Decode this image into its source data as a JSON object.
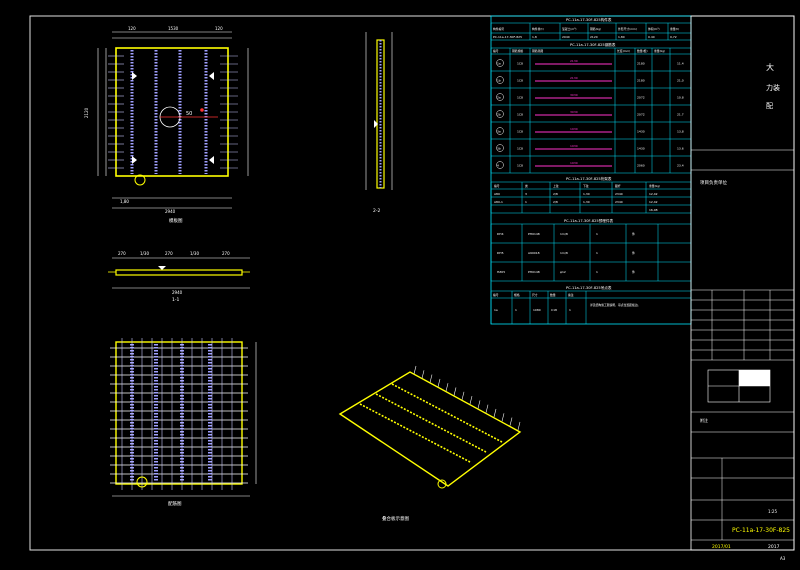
{
  "drawing": {
    "plan_view_label": "模板图",
    "rebar_view_label": "配筋图",
    "iso_view_label": "叠合板示意图",
    "section_1_label": "1-1",
    "section_2_label": "2-2",
    "plan_dims_top": [
      "120",
      "1530",
      "120"
    ],
    "plan_dims_bottom": [
      "1,80",
      "2940"
    ],
    "plan_dims_left": [
      "2120"
    ],
    "section_dims_top": [
      "270",
      "1/30",
      "270",
      "1/30",
      "270"
    ],
    "section_dims_bottom": [
      "2940"
    ],
    "marker_r": "10",
    "marker_s": "50"
  },
  "tables": {
    "component_title": "PC-11a-17-30F-825构件表",
    "component_headers": [
      "构件编号",
      "构件重(t)",
      "混凝土(m³)",
      "钢筋(kg)",
      "外形尺寸(mm)",
      "体积(m³)",
      "重量(t)"
    ],
    "component_row": [
      "PC-11a-17-30F-825",
      "1,8",
      "2940",
      "2120",
      "1,80",
      "0.40",
      "0,72"
    ],
    "rebar_title": "PC-11a-17-30F-825钢筋表",
    "rebar_headers": [
      "编号",
      "钢筋规格",
      "钢筋简图",
      "长度(mm)",
      "数量(根)",
      "重量(kg)"
    ],
    "rebar_rows": [
      {
        "id": "1a",
        "spec": "1C8",
        "len": "2130",
        "qty": "2180",
        "wt": "11.4"
      },
      {
        "id": "1b",
        "spec": "1C8",
        "len": "2130",
        "qty": "2180",
        "wt": "21,0"
      },
      {
        "id": "2a",
        "spec": "1C8",
        "len": "3030",
        "qty": "2072",
        "wt": "10.8"
      },
      {
        "id": "2b",
        "spec": "1C8",
        "len": "3030",
        "qty": "2072",
        "wt": "21.7"
      },
      {
        "id": "3a",
        "spec": "1C8",
        "len": "1930",
        "qty": "1430",
        "wt": "13,8"
      },
      {
        "id": "3b",
        "spec": "1C8",
        "len": "1930",
        "qty": "1430",
        "wt": "13.6"
      },
      {
        "id": "4",
        "spec": "1C8",
        "len": "1930",
        "qty": "2060",
        "wt": "23.4"
      }
    ],
    "truss_title": "PC-11a-17-30F-825桁架表",
    "truss_headers": [
      "编号",
      "类",
      "上弦",
      "下弦",
      "腹杆",
      "重量(kg)"
    ],
    "truss_rows": [
      [
        "A80",
        "3",
        "2/8",
        "1,30",
        "2340",
        "12,42"
      ],
      [
        "A80-1",
        "1",
        "2/8",
        "1,30",
        "2340",
        "12,42"
      ],
      [
        "",
        "",
        "",
        "",
        "",
        "16,08"
      ]
    ],
    "embed_title": "PC-11a-17-30F-825预埋件表",
    "embed_rows": [
      [
        "DH4",
        "PH0148",
        "1m/8",
        "1",
        "件"
      ],
      [
        "DH5",
        "A90018",
        "1m/8",
        "1",
        "件"
      ],
      [
        "HZ05",
        "PH0148",
        "φ12",
        "1",
        "件"
      ]
    ],
    "hoist_title": "PC-11a-17-30F-825吊点表",
    "hoist_headers": [
      "编号",
      "规格",
      "尺寸",
      "数量",
      "备注"
    ],
    "hoist_row": [
      "1a",
      "1",
      "1080",
      "C18",
      "1"
    ],
    "hoist_note": "详见结构施工图说明，吊点位置距板边。"
  },
  "titleblock": {
    "project_char_1": "大",
    "project_chars_2": "力装",
    "project_char_3": "配",
    "design_unit_label": "项目负责单位",
    "notes_label": "附注",
    "scale": "1:25",
    "drawing_title": "PC-11a-17-30F-825",
    "bottom_left": "2017/01",
    "bottom_right": "2017",
    "corner_mark": "A3"
  }
}
